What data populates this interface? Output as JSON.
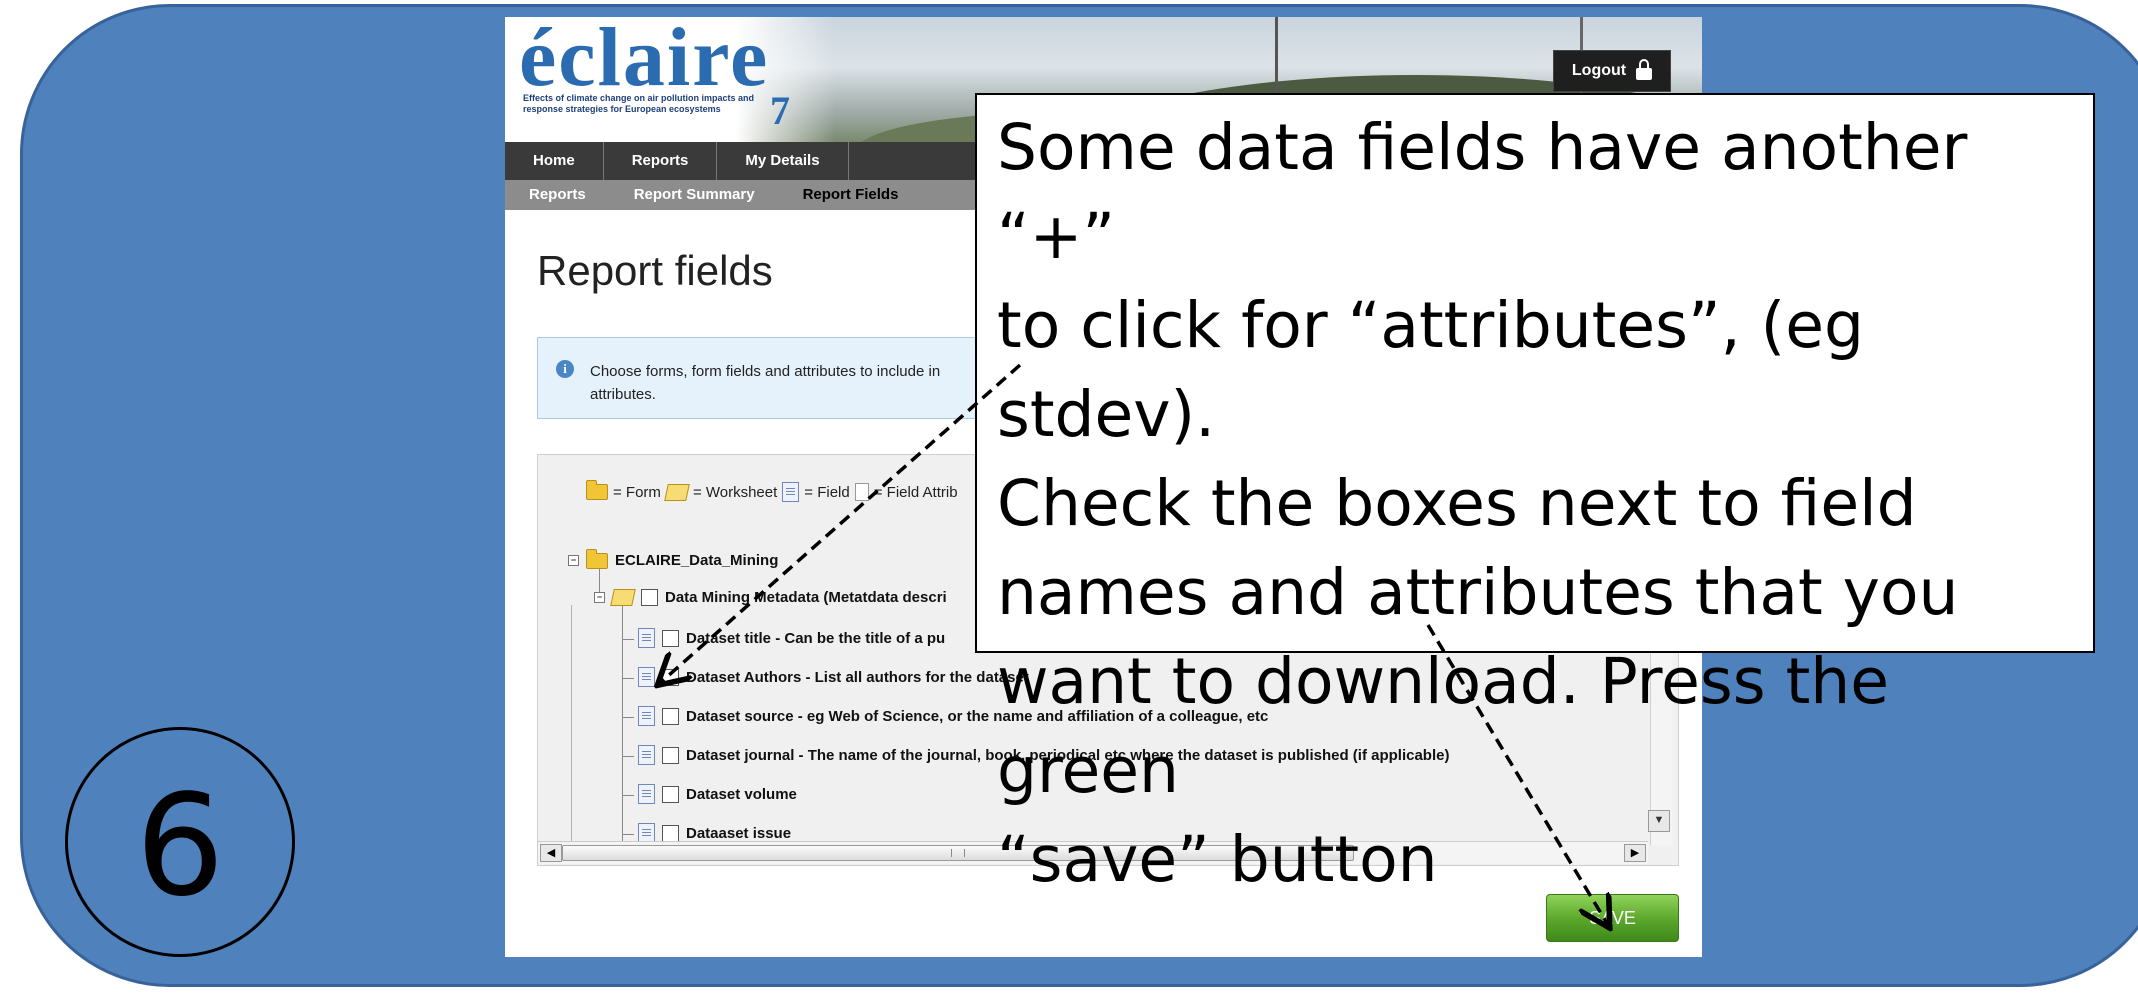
{
  "step": {
    "number": "6"
  },
  "app": {
    "logo": "éclaire",
    "logo_subtitle": "Effects of climate change on air pollution impacts and response strategies for European ecosystems",
    "logout_label": "Logout"
  },
  "nav": {
    "primary": [
      "Home",
      "Reports",
      "My Details"
    ],
    "secondary": [
      "Reports",
      "Report Summary",
      "Report Fields"
    ]
  },
  "page": {
    "title": "Report fields",
    "info_text_line1": "Choose forms, form fields and attributes to include in",
    "info_text_line2": "attributes."
  },
  "legend": {
    "form": "= Form",
    "worksheet": "= Worksheet",
    "field": "= Field",
    "attribute": "= Field Attrib"
  },
  "tree": {
    "root": "ECLAIRE_Data_Mining",
    "worksheet": "Data Mining Metadata (Metatdata descri",
    "fields": [
      "Dataset title - Can be the title of a pu",
      "Dataset Authors - List all authors for the dataset",
      "Dataset source - eg Web of Science, or the name and affiliation of a colleague, etc",
      "Dataset journal - The name of the journal, book, periodical etc where the dataset is published (if applicable)",
      "Dataset volume",
      "Dataaset issue"
    ]
  },
  "save_button": {
    "label": "SAVE"
  },
  "callout": {
    "lines": [
      "Some data fields have another “+”",
      "to click for “attributes”, (eg stdev).",
      "Check the boxes next to field",
      "names and attributes that you",
      "want to download. Press the green",
      "“save” button"
    ]
  },
  "colors": {
    "slide_background": "#4f81bd",
    "save_green": "#5aa52a",
    "nav_dark": "#3a3a3a"
  }
}
